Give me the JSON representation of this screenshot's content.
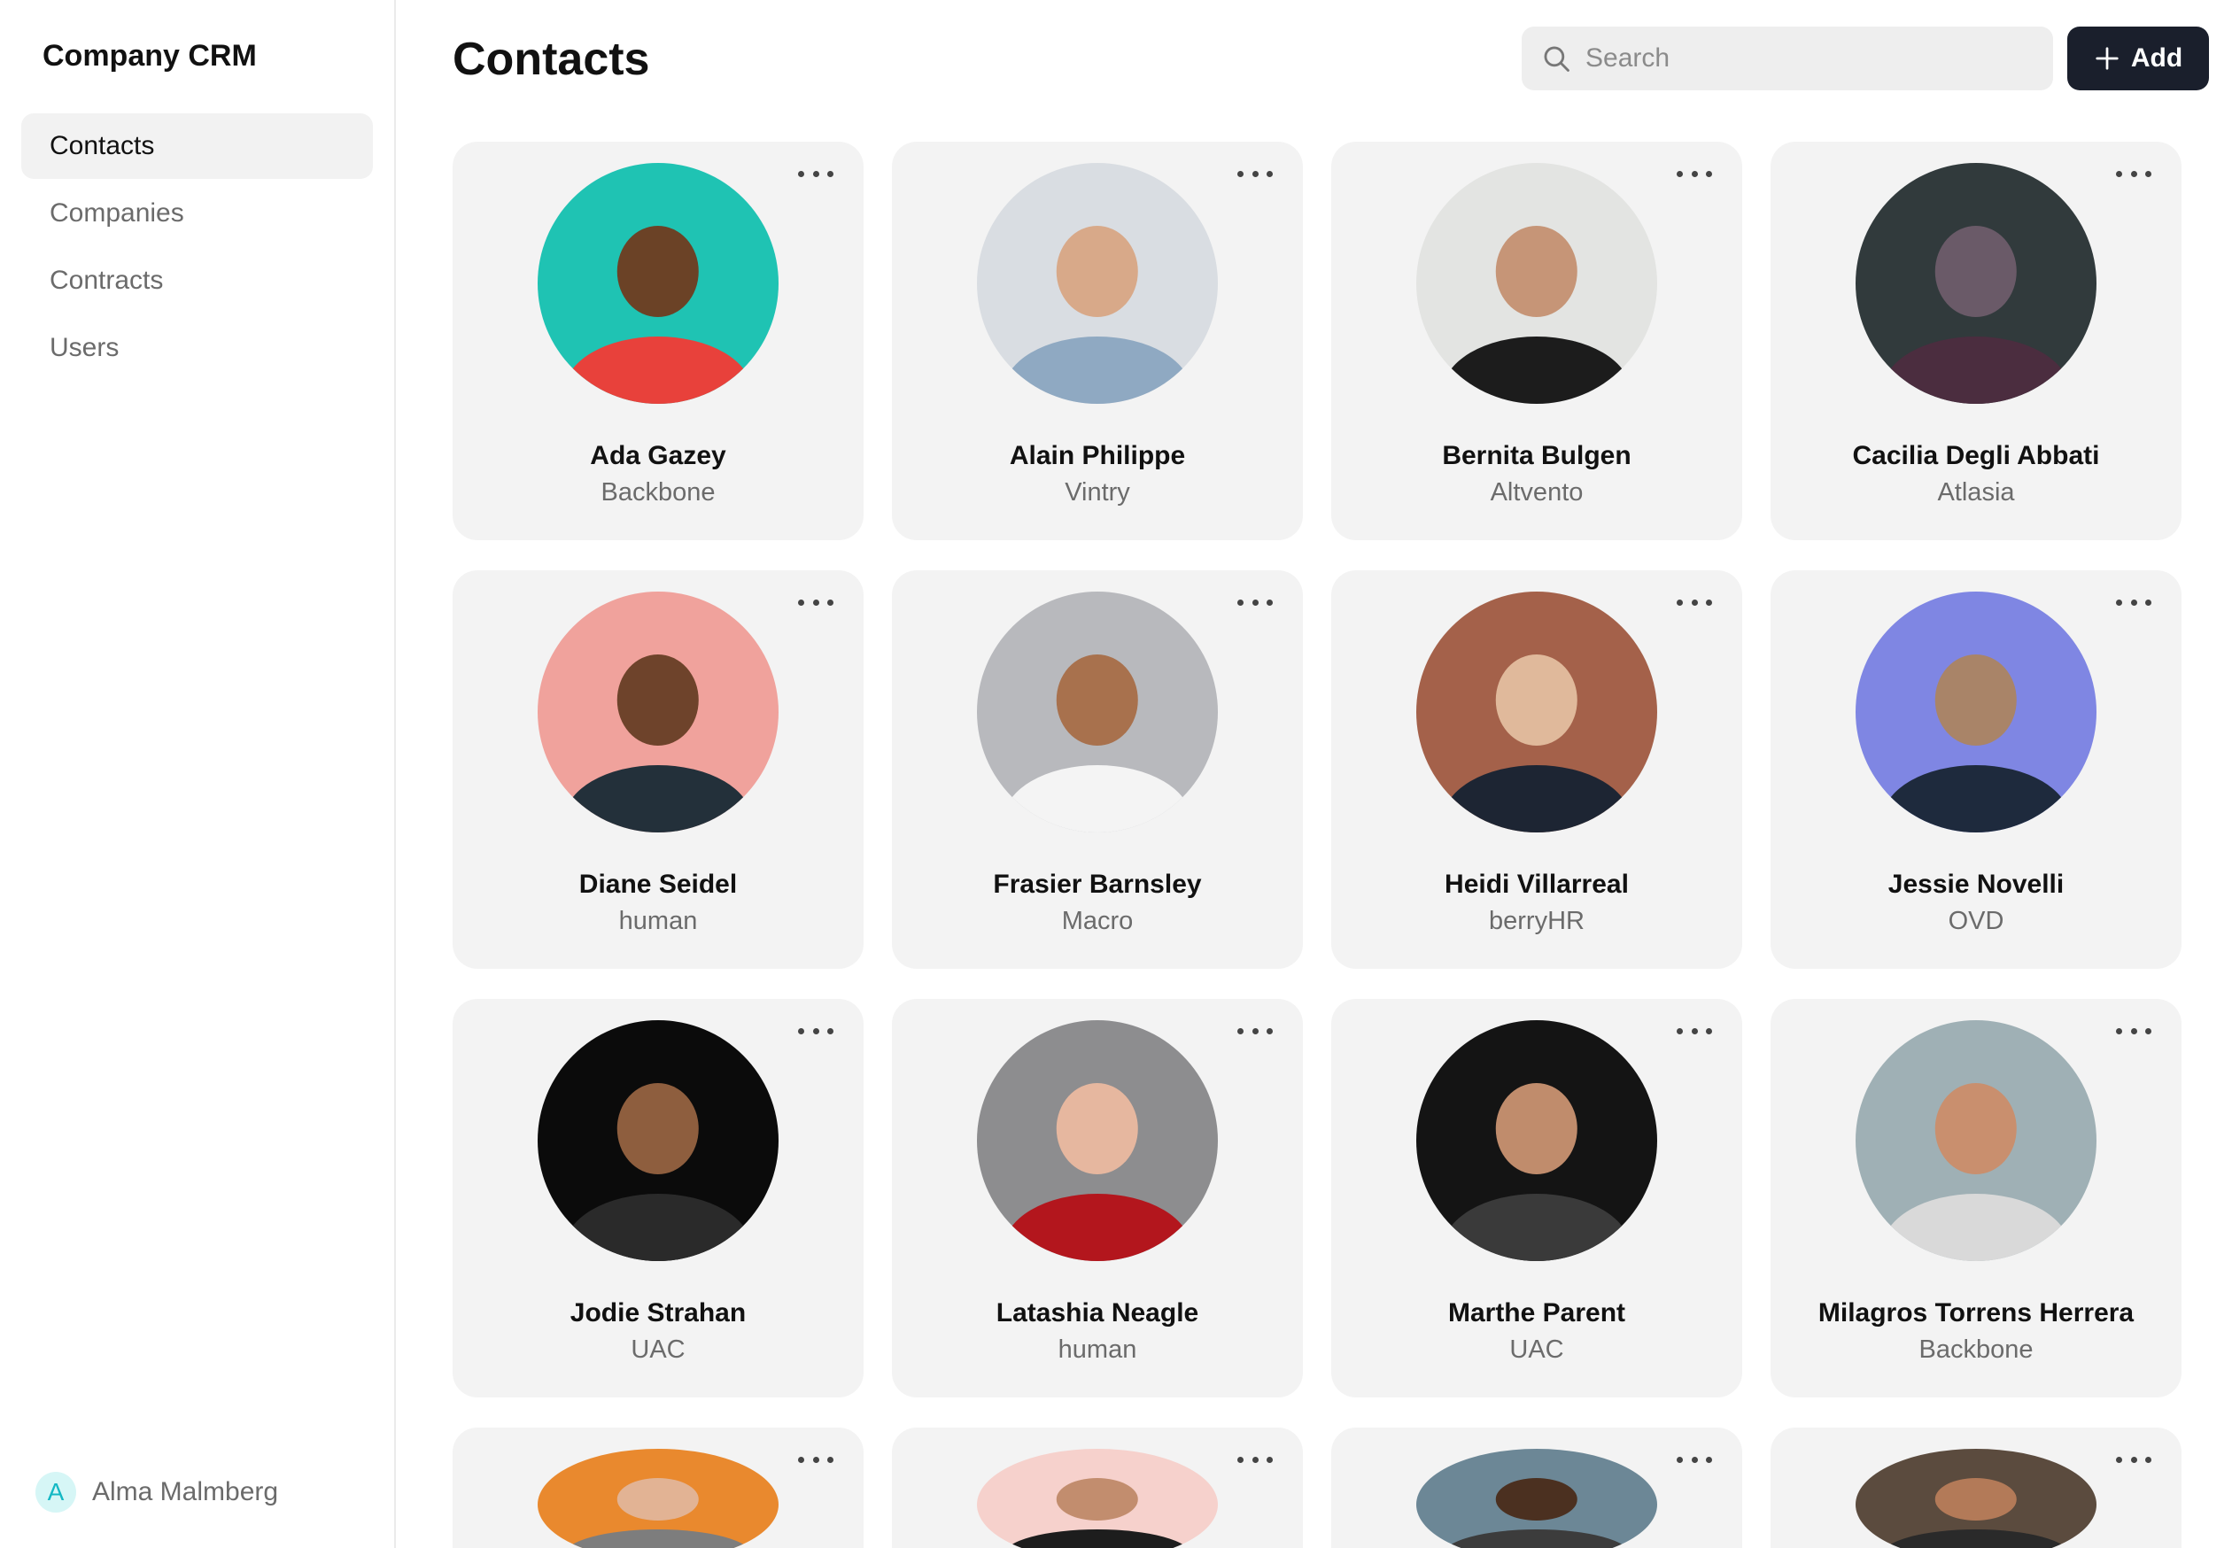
{
  "app": {
    "brand": "Company CRM"
  },
  "sidebar": {
    "items": [
      {
        "label": "Contacts",
        "active": true
      },
      {
        "label": "Companies",
        "active": false
      },
      {
        "label": "Contracts",
        "active": false
      },
      {
        "label": "Users",
        "active": false
      }
    ],
    "user": {
      "initial": "A",
      "name": "Alma Malmberg"
    }
  },
  "header": {
    "title": "Contacts",
    "search_placeholder": "Search",
    "add_label": "Add"
  },
  "contacts": [
    {
      "name": "Ada Gazey",
      "company": "Backbone",
      "bg": "#1fc3b3",
      "skin": "#6b4226",
      "shirt": "#e8413b"
    },
    {
      "name": "Alain Philippe",
      "company": "Vintry",
      "bg": "#d9dde2",
      "skin": "#d8a989",
      "shirt": "#8fa9c2"
    },
    {
      "name": "Bernita Bulgen",
      "company": "Altvento",
      "bg": "#e3e4e2",
      "skin": "#c69577",
      "shirt": "#1c1c1c"
    },
    {
      "name": "Cacilia Degli Abbati",
      "company": "Atlasia",
      "bg": "#313a3c",
      "skin": "#6a5a68",
      "shirt": "#4b2d3f"
    },
    {
      "name": "Diane Seidel",
      "company": "human",
      "bg": "#f0a29c",
      "skin": "#6e432b",
      "shirt": "#23303a"
    },
    {
      "name": "Frasier Barnsley",
      "company": "Macro",
      "bg": "#b8b9bd",
      "skin": "#a8714d",
      "shirt": "#f4f4f4"
    },
    {
      "name": "Heidi Villarreal",
      "company": "berryHR",
      "bg": "#a4614a",
      "skin": "#e0b99b",
      "shirt": "#1d2533"
    },
    {
      "name": "Jessie Novelli",
      "company": "OVD",
      "bg": "#7f86e3",
      "skin": "#a98468",
      "shirt": "#1e2a3d"
    },
    {
      "name": "Jodie Strahan",
      "company": "UAC",
      "bg": "#0b0b0b",
      "skin": "#8e5e3e",
      "shirt": "#2a2a2a"
    },
    {
      "name": "Latashia Neagle",
      "company": "human",
      "bg": "#8d8d8f",
      "skin": "#e6b79f",
      "shirt": "#b3161d"
    },
    {
      "name": "Marthe Parent",
      "company": "UAC",
      "bg": "#141414",
      "skin": "#c08c6c",
      "shirt": "#3a3a3a"
    },
    {
      "name": "Milagros Torrens Herrera",
      "company": "Backbone",
      "bg": "#9fb0b5",
      "skin": "#c98f6e",
      "shirt": "#d9d9d9"
    },
    {
      "name": "",
      "company": "",
      "bg": "#e9892e",
      "skin": "#e2b394",
      "shirt": "#7d7d7d"
    },
    {
      "name": "",
      "company": "",
      "bg": "#f6d1cc",
      "skin": "#c28d6e",
      "shirt": "#1d1d1d"
    },
    {
      "name": "",
      "company": "",
      "bg": "#6c8796",
      "skin": "#4b3020",
      "shirt": "#3c3c3c"
    },
    {
      "name": "",
      "company": "",
      "bg": "#5b4b3e",
      "skin": "#b37a58",
      "shirt": "#2a2a2a"
    }
  ]
}
